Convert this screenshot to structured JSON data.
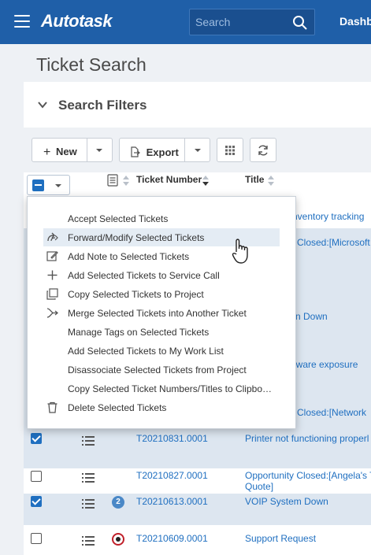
{
  "topbar": {
    "logo": "Autotask",
    "search_placeholder": "Search",
    "nav_partial": "Dashb"
  },
  "page_title": "Ticket Search",
  "filters": {
    "title": "Search Filters"
  },
  "toolbar": {
    "new_label": "New",
    "export_label": "Export"
  },
  "table": {
    "columns": [
      "Ticket Number",
      "Title"
    ],
    "peek_titles": [
      "nventory tracking",
      "Closed:[Microsoft",
      "n Down",
      "lware exposure",
      "Closed:[Network"
    ],
    "rows": [
      {
        "checked": true,
        "number": "T20210831.0001",
        "title": "Printer not functioning properl",
        "badge": ""
      },
      {
        "checked": false,
        "number": "T20210827.0001",
        "title": "Opportunity Closed:[Angela's T",
        "title2": "Quote]",
        "badge": ""
      },
      {
        "checked": true,
        "number": "T20210613.0001",
        "title": "VOIP System Down",
        "badge": "2"
      },
      {
        "checked": false,
        "number": "T20210609.0001",
        "title": "Support Request",
        "badge": "target"
      }
    ]
  },
  "menu": {
    "items": [
      {
        "label": "Accept Selected Tickets",
        "icon": "none"
      },
      {
        "label": "Forward/Modify Selected Tickets",
        "icon": "forward-icon"
      },
      {
        "label": "Add Note to Selected Tickets",
        "icon": "edit-note-icon"
      },
      {
        "label": "Add Selected Tickets to Service Call",
        "icon": "plus-icon"
      },
      {
        "label": "Copy Selected Tickets to Project",
        "icon": "copy-icon"
      },
      {
        "label": "Merge Selected Tickets into Another Ticket",
        "icon": "merge-icon"
      },
      {
        "label": "Manage Tags on Selected Tickets",
        "icon": "none"
      },
      {
        "label": "Add Selected Tickets to My Work List",
        "icon": "none"
      },
      {
        "label": "Disassociate Selected Tickets from Project",
        "icon": "none"
      },
      {
        "label": "Copy Selected Ticket Numbers/Titles to Clipbo…",
        "icon": "none"
      },
      {
        "label": "Delete Selected Tickets",
        "icon": "trash-icon"
      }
    ]
  }
}
